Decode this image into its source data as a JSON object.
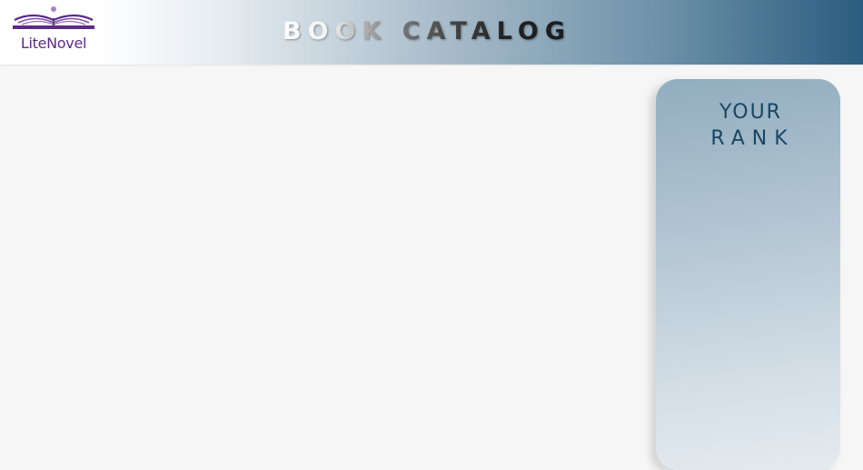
{
  "header": {
    "logo": {
      "icon": "open-book-icon",
      "text": "LiteNovel",
      "color": "#5b2b86"
    },
    "title": "BOOK CATALOG"
  },
  "rank_panel": {
    "title_line1": "YOUR",
    "title_line2": "RANK"
  }
}
